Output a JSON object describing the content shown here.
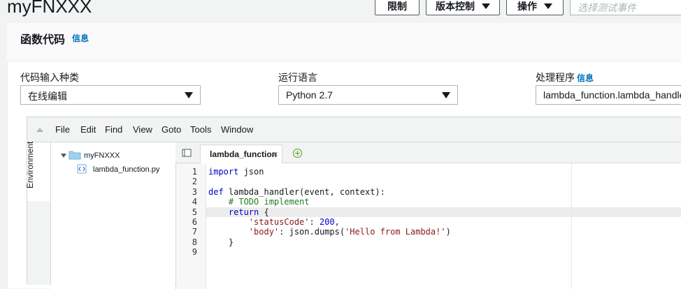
{
  "page_title": "myFNXXX",
  "top_buttons": {
    "throttle": "限制",
    "version_control": "版本控制",
    "actions": "操作"
  },
  "test_event_placeholder": "选择测试事件",
  "panel": {
    "title": "函数代码",
    "info": "信息"
  },
  "fields": {
    "code_entry_type": {
      "label": "代码输入种类",
      "value": "在线编辑"
    },
    "runtime": {
      "label": "运行语言",
      "value": "Python 2.7"
    },
    "handler": {
      "label": "处理程序",
      "info": "信息",
      "value": "lambda_function.lambda_handler"
    }
  },
  "ide": {
    "menu": [
      "File",
      "Edit",
      "Find",
      "View",
      "Goto",
      "Tools",
      "Window"
    ],
    "environment_label": "Environment",
    "tree": {
      "folder": "myFNXXX",
      "file": "lambda_function.py"
    },
    "tab_label": "lambda_function",
    "tab_close": "×",
    "line_numbers": [
      "1",
      "2",
      "3",
      "4",
      "5",
      "6",
      "7",
      "8",
      "9"
    ],
    "code": {
      "l1_kw": "import",
      "l1_rest": " json",
      "l3_kw": "def",
      "l3_rest": " lambda_handler(event, context):",
      "l4_indent": "    ",
      "l4_comment": "# TODO implement",
      "l5_indent": "    ",
      "l5_kw": "return",
      "l5_rest": " {",
      "l6_indent": "        ",
      "l6_str": "'statusCode'",
      "l6_mid": ": ",
      "l6_num": "200",
      "l6_end": ",",
      "l7_indent": "        ",
      "l7_str": "'body'",
      "l7_mid": ": json.dumps(",
      "l7_str2": "'Hello from Lambda!'",
      "l7_end": ")",
      "l8_indent": "    ",
      "l8_text": "}"
    }
  },
  "colors": {
    "link": "#0073bb",
    "keyword": "#0000cc",
    "comment": "#1f7d1f",
    "string": "#8a1a1a"
  }
}
